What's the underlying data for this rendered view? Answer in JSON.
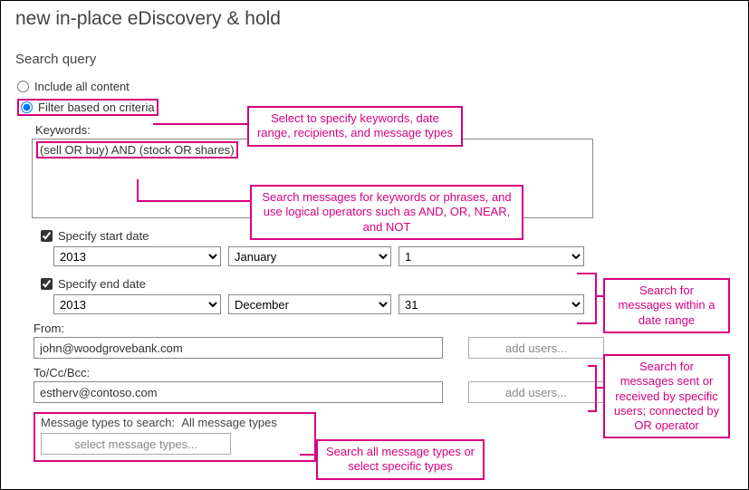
{
  "title": "new in-place eDiscovery & hold",
  "section": "Search query",
  "radio": {
    "include_all": "Include all content",
    "filter_criteria": "Filter based on criteria"
  },
  "keywords": {
    "label": "Keywords:",
    "value": "(sell OR buy) AND (stock OR shares)"
  },
  "start_date": {
    "check_label": "Specify start date",
    "year": "2013",
    "month": "January",
    "day": "1"
  },
  "end_date": {
    "check_label": "Specify end date",
    "year": "2013",
    "month": "December",
    "day": "31"
  },
  "from": {
    "label": "From:",
    "value": "john@woodgrovebank.com",
    "button": "add users..."
  },
  "to": {
    "label": "To/Cc/Bcc:",
    "value": "estherv@contoso.com",
    "button": "add users..."
  },
  "msg_types": {
    "label_prefix": "Message types to search:",
    "label_value": "All message types",
    "button": "select message types..."
  },
  "callouts": {
    "criteria": "Select to specify keywords, date range, recipients, and message types",
    "keywords": "Search messages for keywords or phrases, and use logical operators such as AND, OR, NEAR, and NOT",
    "dates": "Search for messages within a date range",
    "users": "Search for messages sent or received by specific users; connected by OR operator",
    "types": "Search all message types or select specific types"
  }
}
